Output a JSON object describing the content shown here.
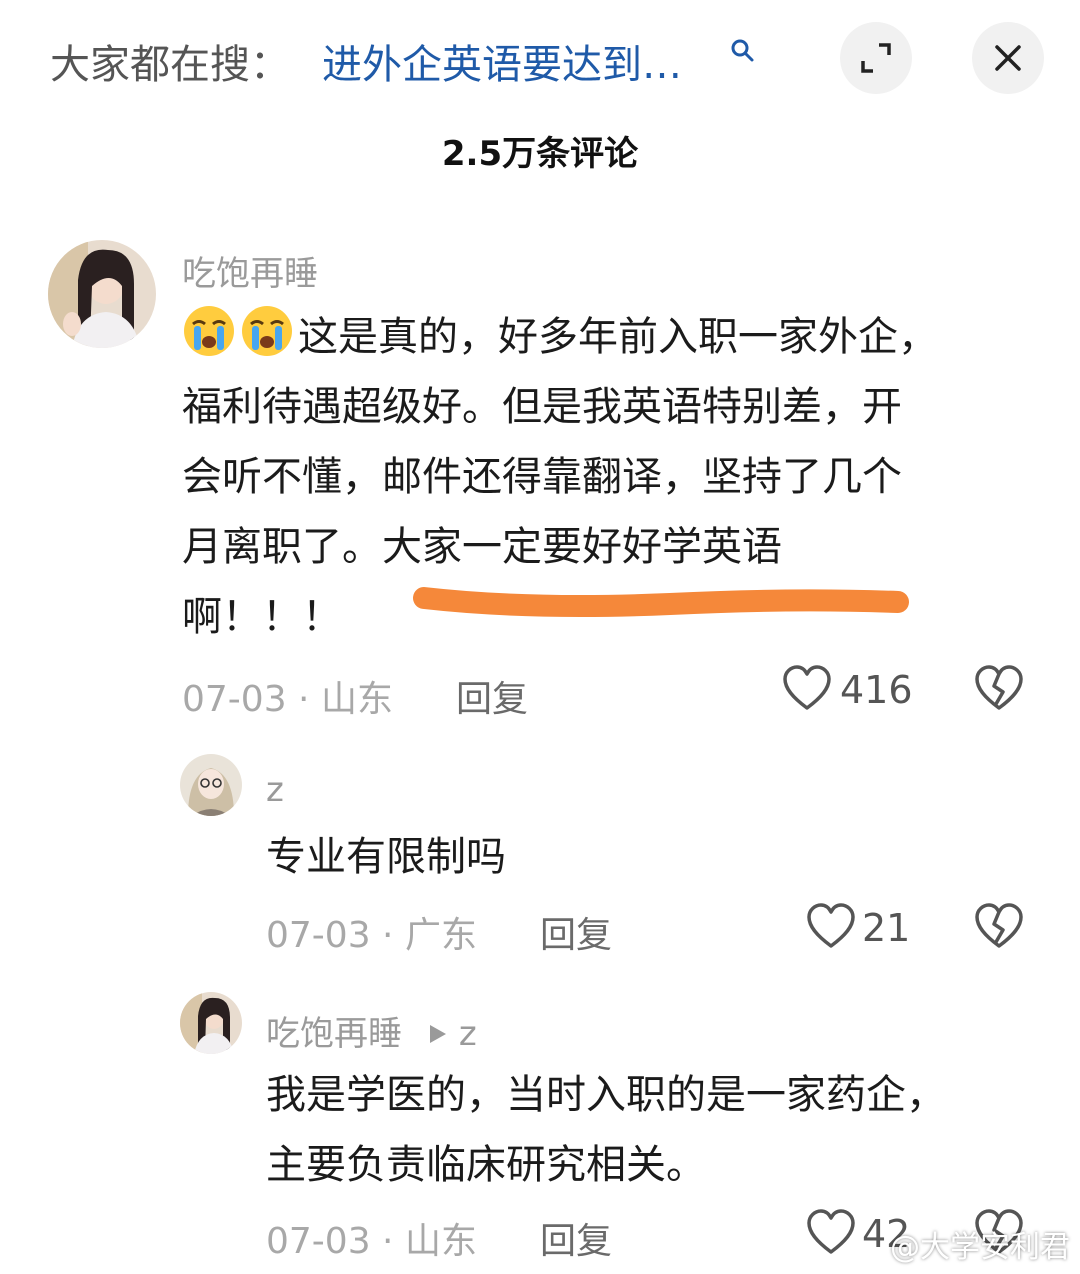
{
  "header": {
    "search_prefix": "大家都在搜：",
    "search_query": "进外企英语要达到…",
    "icons": {
      "search": "search-icon",
      "expand": "collapse-icon",
      "close": "close-icon"
    }
  },
  "comment_count_title": "2.5万条评论",
  "comments": [
    {
      "username": "吃饱再睡",
      "emoji": "crying-emoji",
      "lines": [
        "这是真的，好多年前入职一家外企，",
        "福利待遇超级好。但是我英语特别差，开",
        "会听不懂，邮件还得靠翻译，坚持了几个",
        "月离职了。大家一定要好好学英语",
        "啊！！！"
      ],
      "date": "07-03",
      "location": "山东",
      "reply_label": "回复",
      "likes": "416"
    }
  ],
  "replies": [
    {
      "username": "z",
      "text": "专业有限制吗",
      "date": "07-03",
      "location": "广东",
      "reply_label": "回复",
      "likes": "21"
    },
    {
      "username": "吃饱再睡",
      "reply_to": "z",
      "lines": [
        "我是学医的，当时入职的是一家药企，",
        "主要负责临床研究相关。"
      ],
      "date": "07-03",
      "location": "山东",
      "reply_label": "回复",
      "likes": "42"
    }
  ],
  "colors": {
    "highlight": "#f5883a",
    "link": "#1f5aa8"
  },
  "watermark": "@大学安利君"
}
